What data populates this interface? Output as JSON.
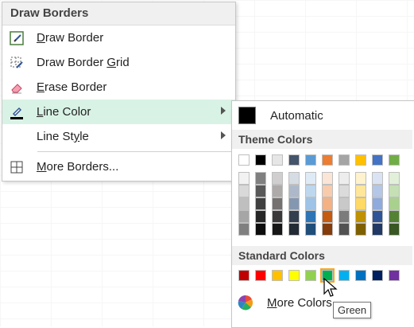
{
  "menu": {
    "header": "Draw Borders",
    "items": [
      {
        "label": "Draw Border",
        "icon": "draw-border-icon"
      },
      {
        "label": "Draw Border Grid",
        "icon": "draw-border-grid-icon"
      },
      {
        "label": "Erase Border",
        "icon": "eraser-icon"
      },
      {
        "label": "Line Color",
        "icon": "line-color-icon"
      },
      {
        "label": "Line Style",
        "icon": ""
      },
      {
        "label": "More Borders...",
        "icon": "borders-grid-icon"
      }
    ]
  },
  "submenu": {
    "automatic_label": "Automatic",
    "theme_header": "Theme Colors",
    "standard_header": "Standard Colors",
    "more_colors_label": "More Colors...",
    "tooltip": "Green",
    "theme_top": [
      "#ffffff",
      "#000000",
      "#e7e6e6",
      "#44546a",
      "#5b9bd5",
      "#ed7d31",
      "#a5a5a5",
      "#ffc000",
      "#4472c4",
      "#70ad47"
    ],
    "theme_shades": [
      [
        "#f2f2f2",
        "#d9d9d9",
        "#bfbfbf",
        "#a6a6a6",
        "#808080"
      ],
      [
        "#808080",
        "#595959",
        "#404040",
        "#262626",
        "#0d0d0d"
      ],
      [
        "#d0cece",
        "#aeaaaa",
        "#757171",
        "#3a3838",
        "#171616"
      ],
      [
        "#d6dce4",
        "#adb9ca",
        "#8497b0",
        "#333f4f",
        "#222a35"
      ],
      [
        "#deebf7",
        "#bdd7ee",
        "#9dc3e6",
        "#2e75b6",
        "#1f4e79"
      ],
      [
        "#fbe5d6",
        "#f8cbad",
        "#f4b183",
        "#c55a11",
        "#843c0c"
      ],
      [
        "#ededed",
        "#dbdbdb",
        "#c9c9c9",
        "#7b7b7b",
        "#525252"
      ],
      [
        "#fff2cc",
        "#ffe699",
        "#ffd966",
        "#bf9000",
        "#7f6000"
      ],
      [
        "#dae3f3",
        "#b4c7e7",
        "#8faadc",
        "#2f5597",
        "#203864"
      ],
      [
        "#e2f0d9",
        "#c5e0b4",
        "#a9d18e",
        "#548235",
        "#385723"
      ]
    ],
    "standard": [
      "#c00000",
      "#ff0000",
      "#ffc000",
      "#ffff00",
      "#92d050",
      "#00b050",
      "#00b0f0",
      "#0070c0",
      "#002060",
      "#7030a0"
    ],
    "selected_standard_index": 5
  }
}
